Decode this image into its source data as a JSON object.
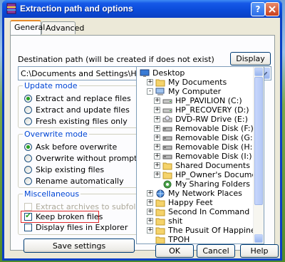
{
  "window": {
    "title": "Extraction path and options"
  },
  "tabs": [
    {
      "label": "General",
      "active": true
    },
    {
      "label": "Advanced",
      "active": false
    }
  ],
  "destination": {
    "label": "Destination path (will be created if does not exist)",
    "display_button": "Display",
    "path": "C:\\Documents and Settings\\HP_Owner\\Desktop\\TPOH"
  },
  "update_mode": {
    "title": "Update mode",
    "options": [
      {
        "label": "Extract and replace files",
        "selected": true
      },
      {
        "label": "Extract and update files",
        "selected": false
      },
      {
        "label": "Fresh existing files only",
        "selected": false
      }
    ]
  },
  "overwrite_mode": {
    "title": "Overwrite mode",
    "options": [
      {
        "label": "Ask before overwrite",
        "selected": true
      },
      {
        "label": "Overwrite without prompt",
        "selected": false
      },
      {
        "label": "Skip existing files",
        "selected": false
      },
      {
        "label": "Rename automatically",
        "selected": false
      }
    ]
  },
  "misc": {
    "title": "Miscellaneous",
    "options": [
      {
        "label": "Extract archives to subfolders",
        "checked": false,
        "disabled": true
      },
      {
        "label": "Keep broken files",
        "checked": true,
        "disabled": false
      },
      {
        "label": "Display files in Explorer",
        "checked": false,
        "disabled": false
      }
    ]
  },
  "save_settings": "Save settings",
  "tree": [
    {
      "label": "Desktop",
      "icon": "desktop-icon",
      "expander": ""
    },
    {
      "label": "My Documents",
      "icon": "folder-icon",
      "expander": "+"
    },
    {
      "label": "My Computer",
      "icon": "computer-icon",
      "expander": "-"
    },
    {
      "label": "HP_PAVILION (C:)",
      "icon": "drive-icon",
      "expander": "+"
    },
    {
      "label": "HP_RECOVERY (D:)",
      "icon": "drive-icon",
      "expander": "+"
    },
    {
      "label": "DVD-RW Drive (E:)",
      "icon": "dvd-icon",
      "expander": "+"
    },
    {
      "label": "Removable Disk (F:)",
      "icon": "removable-disk-icon",
      "expander": "+"
    },
    {
      "label": "Removable Disk (G:)",
      "icon": "removable-disk-icon",
      "expander": "+"
    },
    {
      "label": "Removable Disk (H:)",
      "icon": "removable-disk-icon",
      "expander": "+"
    },
    {
      "label": "Removable Disk (I:)",
      "icon": "removable-disk-icon",
      "expander": "+"
    },
    {
      "label": "Shared Documents",
      "icon": "folder-icon",
      "expander": "+"
    },
    {
      "label": "HP_Owner's Documents",
      "icon": "folder-icon",
      "expander": "+"
    },
    {
      "label": "My Sharing Folders",
      "icon": "sharing-folder-icon",
      "expander": ""
    },
    {
      "label": "My Network Places",
      "icon": "network-icon",
      "expander": "+"
    },
    {
      "label": "Happy Feet",
      "icon": "folder-icon",
      "expander": "+"
    },
    {
      "label": "Second In Command",
      "icon": "folder-icon",
      "expander": "+"
    },
    {
      "label": "shit",
      "icon": "folder-icon",
      "expander": "+"
    },
    {
      "label": "The Pusuit Of Happiness",
      "icon": "folder-icon",
      "expander": "+"
    },
    {
      "label": "TPOH",
      "icon": "folder-icon",
      "expander": ""
    }
  ],
  "buttons": {
    "ok": "OK",
    "cancel": "Cancel",
    "help": "Help"
  },
  "colors": {
    "title_blue": "#0a4ad8",
    "group_title": "#0046d5",
    "highlight_red": "#e0292b",
    "check_green": "#21a121"
  }
}
